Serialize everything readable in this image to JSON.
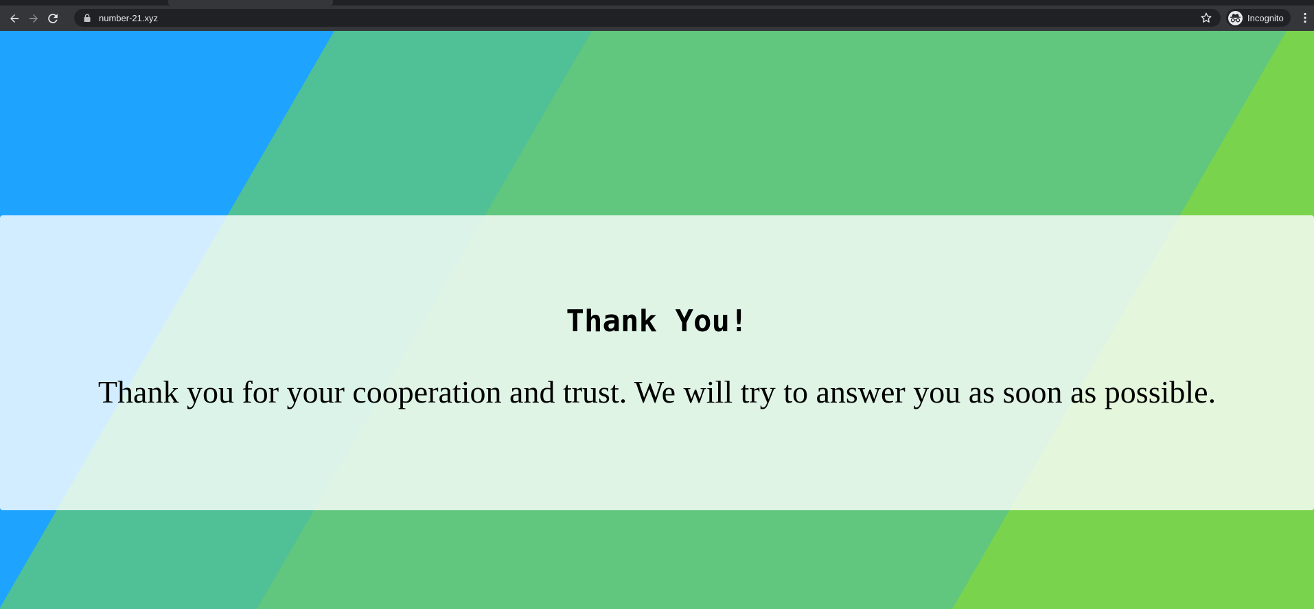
{
  "browser": {
    "url": "number-21.xyz",
    "profile_label": "Incognito",
    "icons": {
      "back": "arrow-left-icon",
      "forward": "arrow-right-icon",
      "reload": "reload-icon",
      "lock": "lock-icon",
      "bookmark": "star-icon",
      "profile": "incognito-icon",
      "menu": "kebab-menu-icon"
    }
  },
  "page": {
    "title": "Thank You!",
    "message": "Thank you for your cooperation and trust. We will try to answer you as soon as possible.",
    "colors": {
      "blue": "#1ea4ff",
      "teal": "#50c096",
      "green": "#61c67e",
      "lime": "#79d34c"
    }
  }
}
